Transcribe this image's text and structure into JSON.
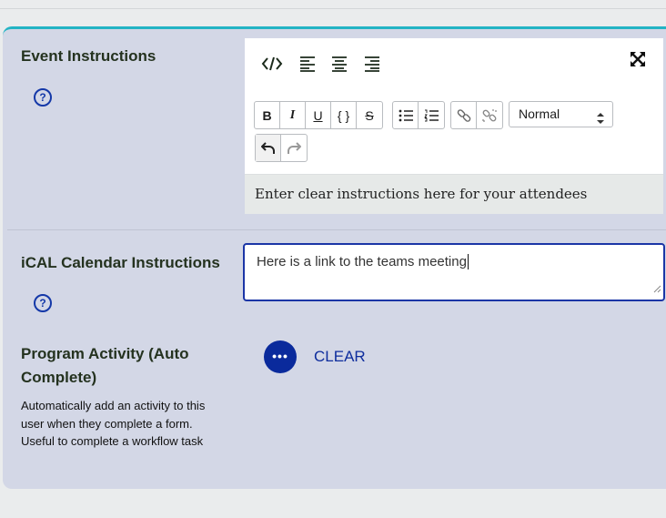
{
  "event_instructions": {
    "label": "Event Instructions",
    "help_icon": "question-circle-icon",
    "toolbar_top": [
      "code-icon",
      "align-left-icon",
      "align-center-icon",
      "align-right-icon",
      "fullscreen-icon"
    ],
    "format_buttons": {
      "bold": "B",
      "italic": "I",
      "underline": "U",
      "code_block": "{ }",
      "strikethrough": "S"
    },
    "list_buttons": [
      "bullet-list-icon",
      "numbered-list-icon"
    ],
    "link_buttons": [
      "link-icon",
      "unlink-icon"
    ],
    "style_select": "Normal",
    "history_buttons": [
      "undo-icon",
      "redo-icon"
    ],
    "placeholder": "Enter clear instructions here for your attendees"
  },
  "ical": {
    "label": "iCAL Calendar Instructions",
    "value": "Here is a link to the teams meeting",
    "help_icon": "question-circle-icon"
  },
  "program_activity": {
    "label_line1": "Program Activity (Auto",
    "label_line2": "Complete)",
    "desc_line1": "Automatically add an activity to this",
    "desc_line2": "user when they complete a form.",
    "desc_line3": "Useful to complete a workflow task",
    "more_button": "•••",
    "clear_label": "CLEAR"
  },
  "colors": {
    "accent": "#23b4c4",
    "primary": "#0a2a9c",
    "card_bg": "#d3d7e6"
  }
}
